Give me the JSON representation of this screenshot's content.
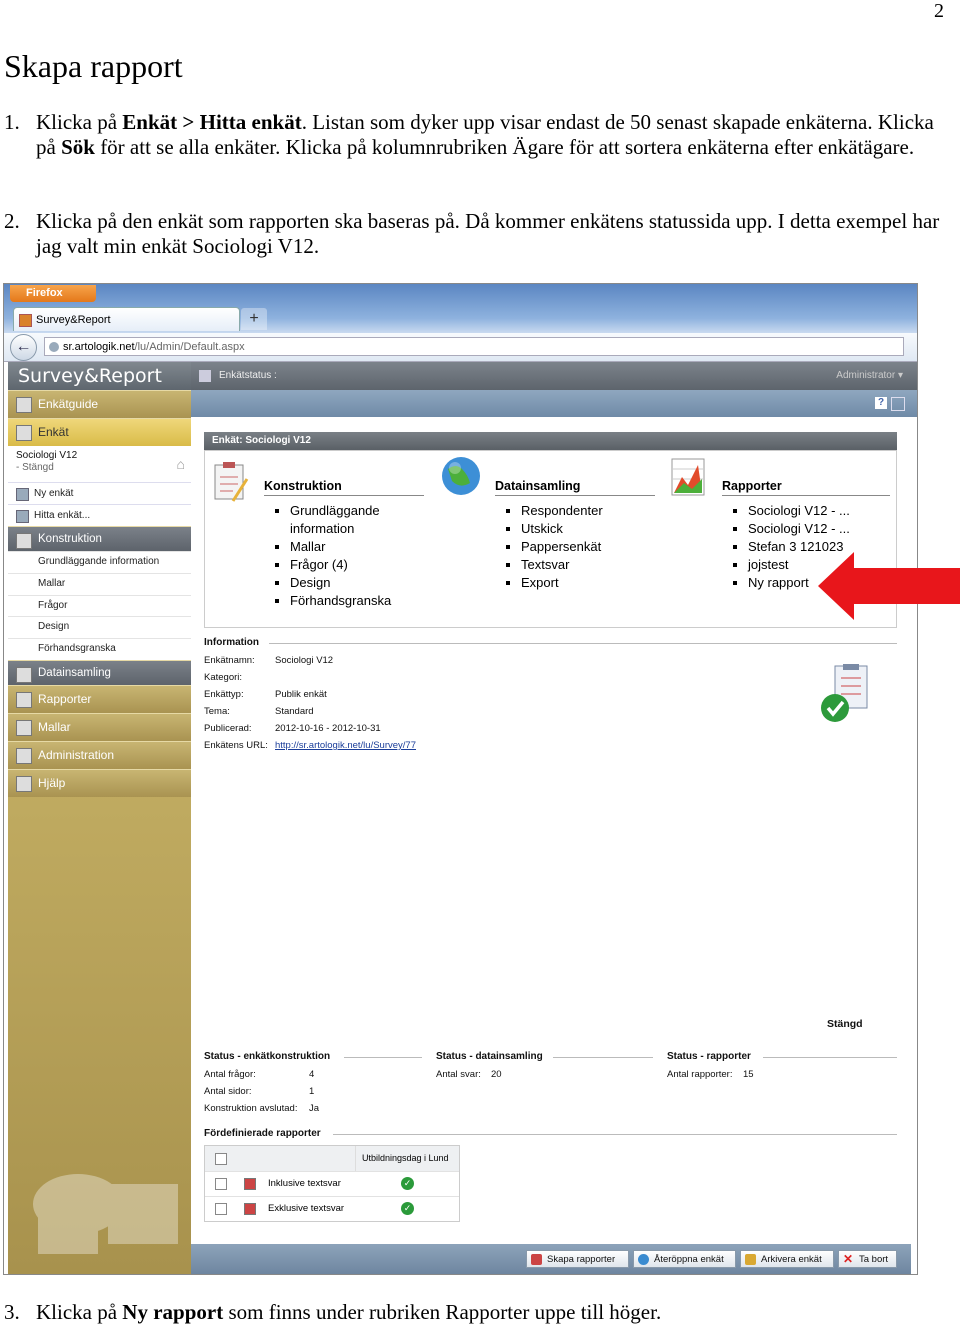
{
  "page_number": "2",
  "title": "Skapa rapport",
  "steps": [
    {
      "num": "1.",
      "parts": [
        "Klicka på ",
        "Enkät > Hitta enkät",
        ". Listan som dyker upp visar endast de 50 senast skapade enkäterna. Klicka på ",
        "Sök",
        " för att se alla enkäter. Klicka på kolumnrubriken Ägare för att sortera enkäterna efter enkätägare."
      ]
    },
    {
      "num": "2.",
      "text": "Klicka på den enkät som rapporten ska baseras på. Då kommer enkätens statussida upp. I detta exempel har jag valt min enkät Sociologi V12."
    },
    {
      "num": "3.",
      "parts": [
        "Klicka på ",
        "Ny rapport",
        " som finns under rubriken Rapporter uppe till höger."
      ]
    }
  ],
  "browser": {
    "app_button": "Firefox",
    "tab_title": "Survey&Report",
    "new_tab": "+",
    "url_host": "sr.artologik.net",
    "url_path": "/lu/Admin/Default.aspx"
  },
  "sidebar": {
    "logo": "Survey&Report",
    "enkatguide": "Enkätguide",
    "enkat": "Enkät",
    "survey_name": "Sociologi V12",
    "survey_state": "- Stängd",
    "ny_enkat": "Ny enkät",
    "hitta_enkat": "Hitta enkät...",
    "konstruktion": "Konstruktion",
    "konstruktion_items": [
      "Grundläggande information",
      "Mallar",
      "Frågor",
      "Design",
      "Förhandsgranska"
    ],
    "datainsamling": "Datainsamling",
    "rapporter": "Rapporter",
    "mallar": "Mallar",
    "administration": "Administration",
    "hjalp": "Hjälp"
  },
  "topbar": {
    "crumb": "Enkätstatus :",
    "user": "Administrator",
    "help": "?"
  },
  "panel": {
    "header": "Enkät: Sociologi V12",
    "konstruktion": {
      "title": "Konstruktion",
      "items": [
        "Grundläggande information",
        "Mallar",
        "Frågor (4)",
        "Design",
        "Förhandsgranska"
      ]
    },
    "datainsamling": {
      "title": "Datainsamling",
      "items": [
        "Respondenter",
        "Utskick",
        "Pappersenkät",
        "Textsvar",
        "Export"
      ]
    },
    "rapporter": {
      "title": "Rapporter",
      "items": [
        "Sociologi V12 - ...",
        "Sociologi V12 - ...",
        "Stefan 3 121023",
        "jojstest",
        "Ny rapport"
      ]
    }
  },
  "information": {
    "header": "Information",
    "rows": [
      {
        "k": "Enkätnamn:",
        "v": "Sociologi V12"
      },
      {
        "k": "Kategori:",
        "v": ""
      },
      {
        "k": "Enkättyp:",
        "v": "Publik enkät"
      },
      {
        "k": "Tema:",
        "v": "Standard"
      },
      {
        "k": "Publicerad:",
        "v": "2012-10-16 - 2012-10-31"
      },
      {
        "k": "Enkätens URL:",
        "v": "http://sr.artologik.net/lu/Survey/77"
      }
    ],
    "status_label": "Stängd"
  },
  "status": {
    "konstruktion": {
      "header": "Status - enkätkonstruktion",
      "rows": [
        {
          "k": "Antal frågor:",
          "v": "4"
        },
        {
          "k": "Antal sidor:",
          "v": "1"
        },
        {
          "k": "Konstruktion avslutad:",
          "v": "Ja"
        }
      ]
    },
    "datainsamling": {
      "header": "Status - datainsamling",
      "rows": [
        {
          "k": "Antal svar:",
          "v": "20"
        }
      ]
    },
    "rapporter": {
      "header": "Status - rapporter",
      "rows": [
        {
          "k": "Antal rapporter:",
          "v": "15"
        }
      ]
    }
  },
  "predefined": {
    "header": "Fördefinierade rapporter",
    "column": "Utbildningsdag i Lund",
    "rows": [
      "Inklusive textsvar",
      "Exklusive textsvar"
    ]
  },
  "footer_buttons": [
    "Skapa rapporter",
    "Återöppna enkät",
    "Arkivera enkät",
    "Ta bort"
  ],
  "colors": {
    "arrow": "#e8161b",
    "sidebar": "#b9a55d",
    "panel_header": "#6a7076"
  }
}
